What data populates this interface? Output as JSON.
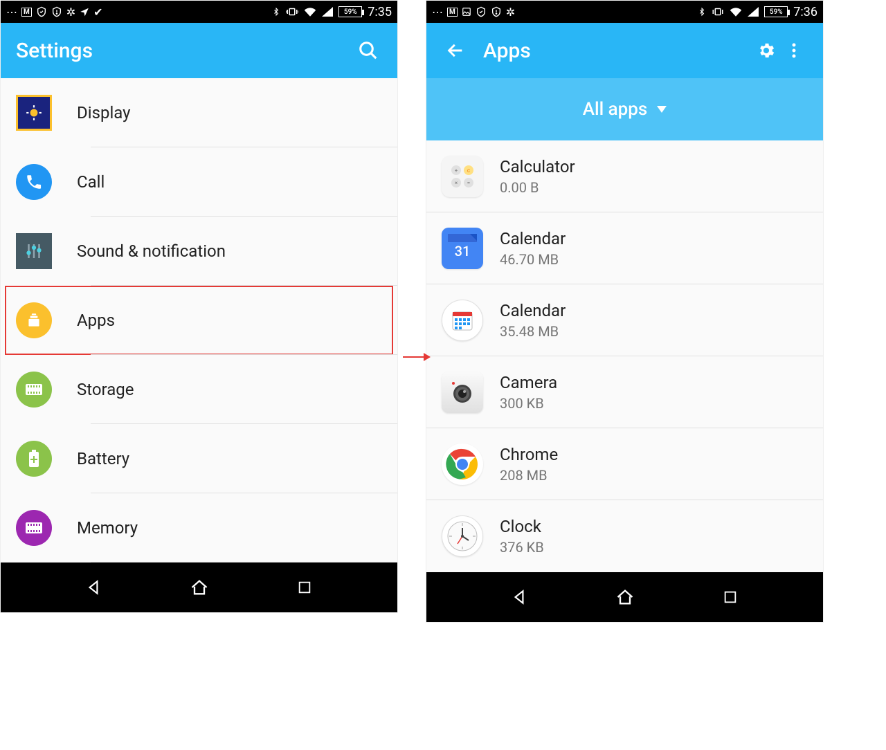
{
  "left": {
    "status": {
      "battery": "59%",
      "time": "7:35"
    },
    "appbar": {
      "title": "Settings"
    },
    "items": [
      {
        "label": "Display"
      },
      {
        "label": "Call"
      },
      {
        "label": "Sound & notification"
      },
      {
        "label": "Apps"
      },
      {
        "label": "Storage"
      },
      {
        "label": "Battery"
      },
      {
        "label": "Memory"
      }
    ]
  },
  "right": {
    "status": {
      "battery": "59%",
      "time": "7:36"
    },
    "appbar": {
      "title": "Apps"
    },
    "subbar": {
      "label": "All apps"
    },
    "apps": [
      {
        "name": "Calculator",
        "size": "0.00 B"
      },
      {
        "name": "Calendar",
        "size": "46.70 MB"
      },
      {
        "name": "Calendar",
        "size": "35.48 MB"
      },
      {
        "name": "Camera",
        "size": "300 KB"
      },
      {
        "name": "Chrome",
        "size": "208 MB"
      },
      {
        "name": "Clock",
        "size": "376 KB"
      }
    ]
  }
}
